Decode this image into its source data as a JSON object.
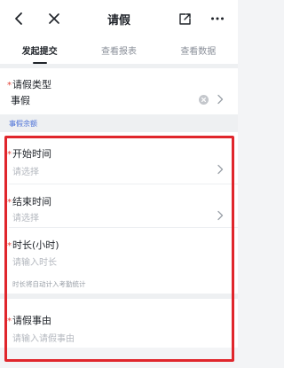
{
  "navbar": {
    "title": "请假",
    "back_icon": "chevron-left-icon",
    "close_icon": "close-icon",
    "share_icon": "share-icon",
    "more_icon": "more-icon"
  },
  "tabs": [
    {
      "label": "发起提交",
      "active": true
    },
    {
      "label": "查看报表",
      "active": false
    },
    {
      "label": "查看数据",
      "active": false
    }
  ],
  "required_mark": "*",
  "leave_type": {
    "label": "请假类型",
    "value": "事假"
  },
  "balance_label": "事假余额",
  "fields": {
    "start": {
      "label": "开始时间",
      "placeholder": "请选择"
    },
    "end": {
      "label": "结束时间",
      "placeholder": "请选择"
    },
    "duration": {
      "label": "时长(小时)",
      "placeholder": "请输入时长",
      "hint": "时长将自动计入考勤统计"
    },
    "reason": {
      "label": "请假事由",
      "placeholder": "请输入请假事由"
    }
  },
  "colors": {
    "accent": "#4a6fd7",
    "required": "#e2453a",
    "highlight": "#e0262c"
  }
}
